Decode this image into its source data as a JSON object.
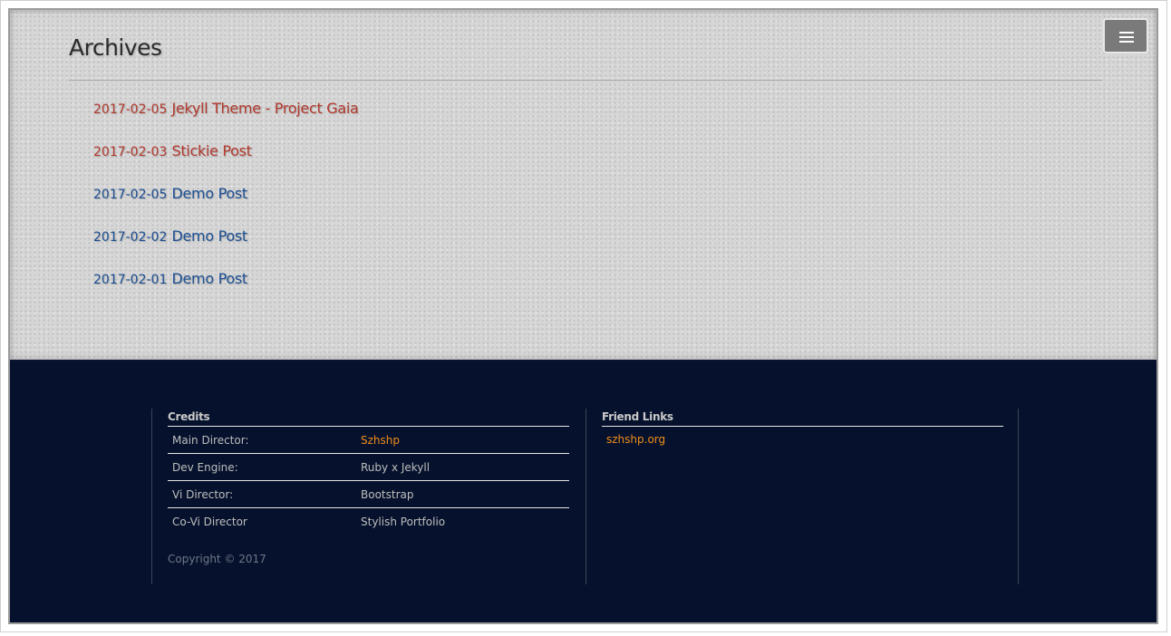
{
  "header": {
    "menu_icon": "hamburger-menu-icon"
  },
  "archives": {
    "title": "Archives",
    "posts": [
      {
        "date": "2017-02-05",
        "title": "Jekyll Theme - Project Gaia",
        "sticky": true
      },
      {
        "date": "2017-02-03",
        "title": "Stickie Post",
        "sticky": true
      },
      {
        "date": "2017-02-05",
        "title": "Demo Post",
        "sticky": false
      },
      {
        "date": "2017-02-02",
        "title": "Demo Post",
        "sticky": false
      },
      {
        "date": "2017-02-01",
        "title": "Demo Post",
        "sticky": false
      }
    ]
  },
  "footer": {
    "credits": {
      "heading": "Credits",
      "rows": [
        {
          "label": "Main Director:",
          "value": "Szhshp"
        },
        {
          "label": "Dev Engine:",
          "value": "Ruby x Jekyll"
        },
        {
          "label": "Vi Director:",
          "value": "Bootstrap"
        },
        {
          "label": "Co-Vi Director",
          "value": "Stylish Portfolio"
        }
      ],
      "copyright": "Copyright © 2017"
    },
    "friend_links": {
      "heading": "Friend Links",
      "links": [
        "szhshp.org"
      ]
    }
  },
  "colors": {
    "sticky_post": "#b33a2e",
    "normal_post": "#1d4f94",
    "footer_bg": "#06122d",
    "link_accent": "#f08c1a"
  }
}
